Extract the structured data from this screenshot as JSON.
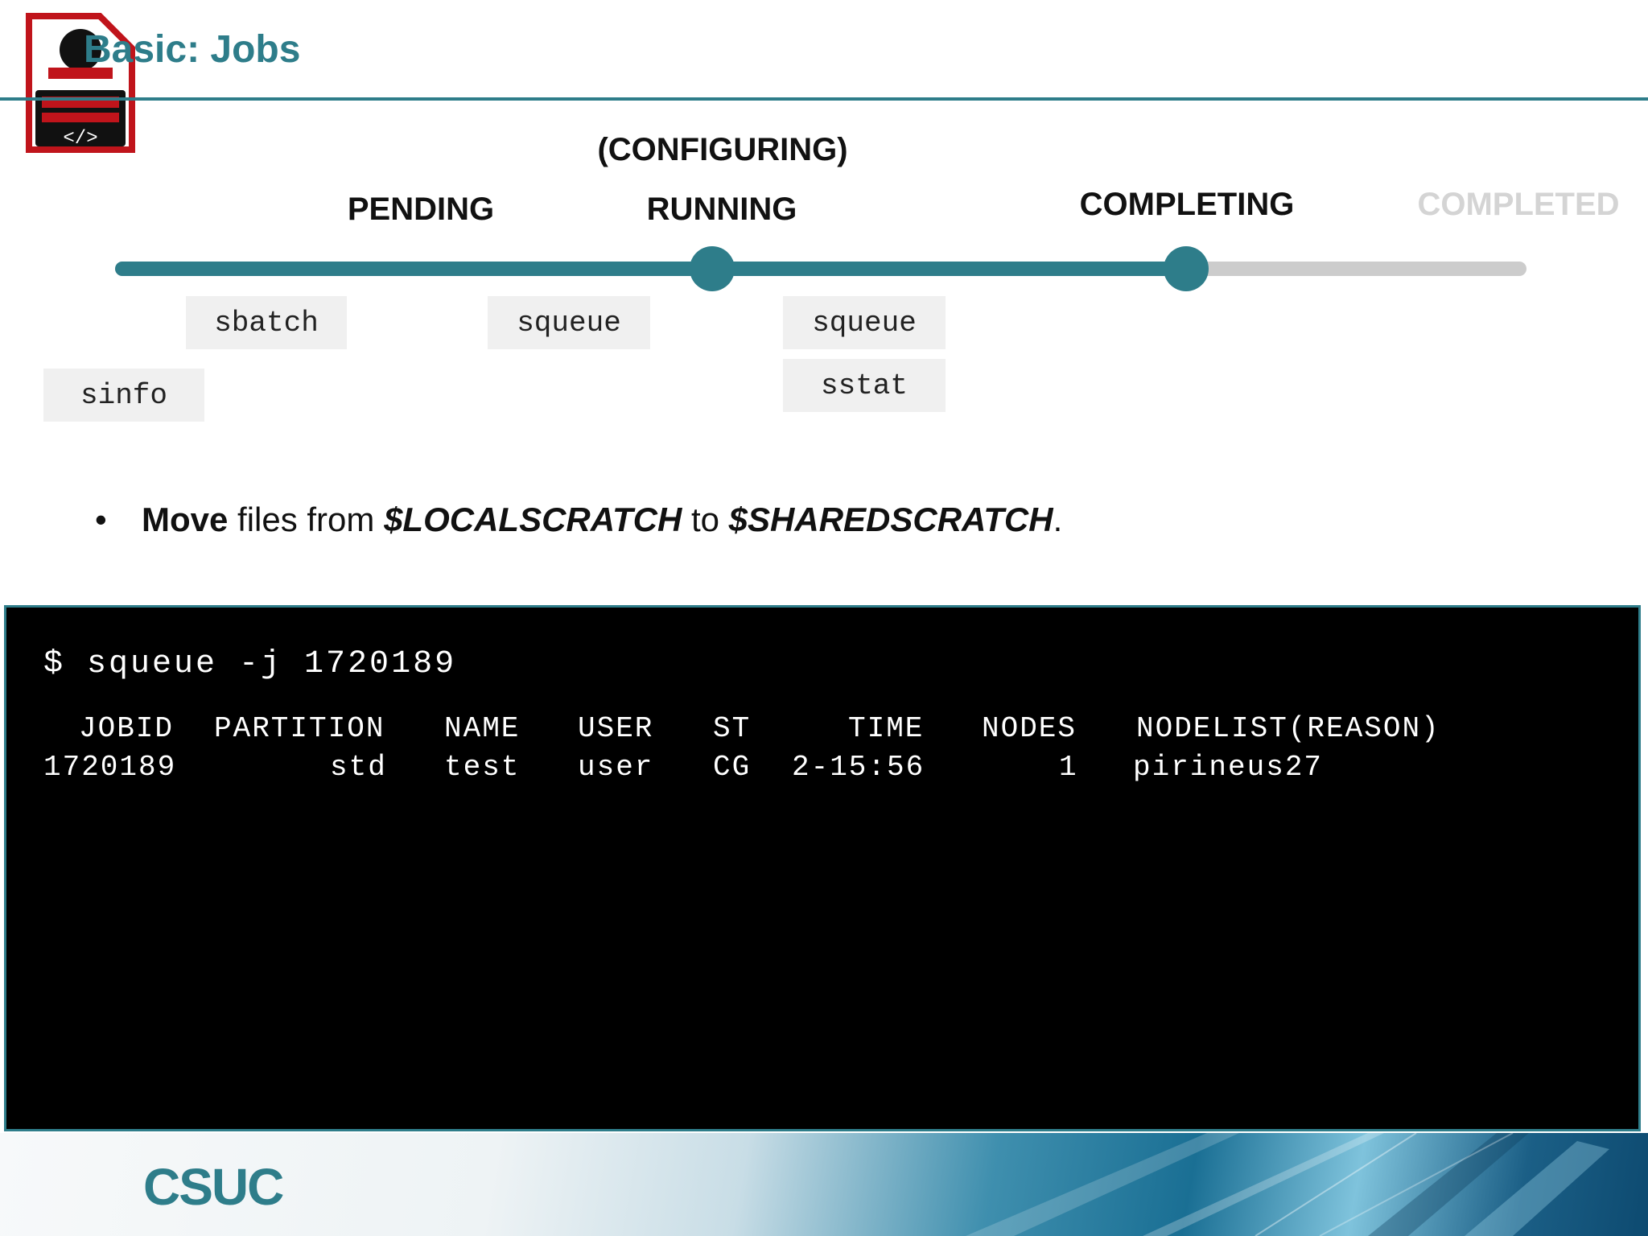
{
  "slide": {
    "title": "Basic: Jobs",
    "accent_color": "#2e7d8a",
    "logo_icon": "code-document-icon"
  },
  "states": {
    "configuring": "(CONFIGURING)",
    "pending": "PENDING",
    "running": "RUNNING",
    "completing": "COMPLETING",
    "completed": "COMPLETED"
  },
  "commands": {
    "sbatch": "sbatch",
    "squeue_pending": "squeue",
    "squeue_running": "squeue",
    "sstat": "sstat",
    "sinfo": "sinfo"
  },
  "bullet": {
    "verb": "Move",
    "text_1": " files from ",
    "source": "$LOCALSCRATCH",
    "text_2": " to ",
    "dest": "$SHAREDSCRATCH",
    "end": "."
  },
  "terminal": {
    "command": "$ squeue -j 1720189",
    "headers": {
      "jobid": "JOBID",
      "partition": "PARTITION",
      "name": "NAME",
      "user": "USER",
      "st": "ST",
      "time": "TIME",
      "nodes": "NODES",
      "nodelist": "NODELIST(REASON)"
    },
    "row": {
      "jobid": "1720189",
      "partition": "std",
      "name": "test",
      "user": "user",
      "st": "CG",
      "time": "2-15:56",
      "nodes": "1",
      "nodelist": "pirineus27"
    }
  },
  "footer": {
    "logo_text": "CSUC"
  }
}
